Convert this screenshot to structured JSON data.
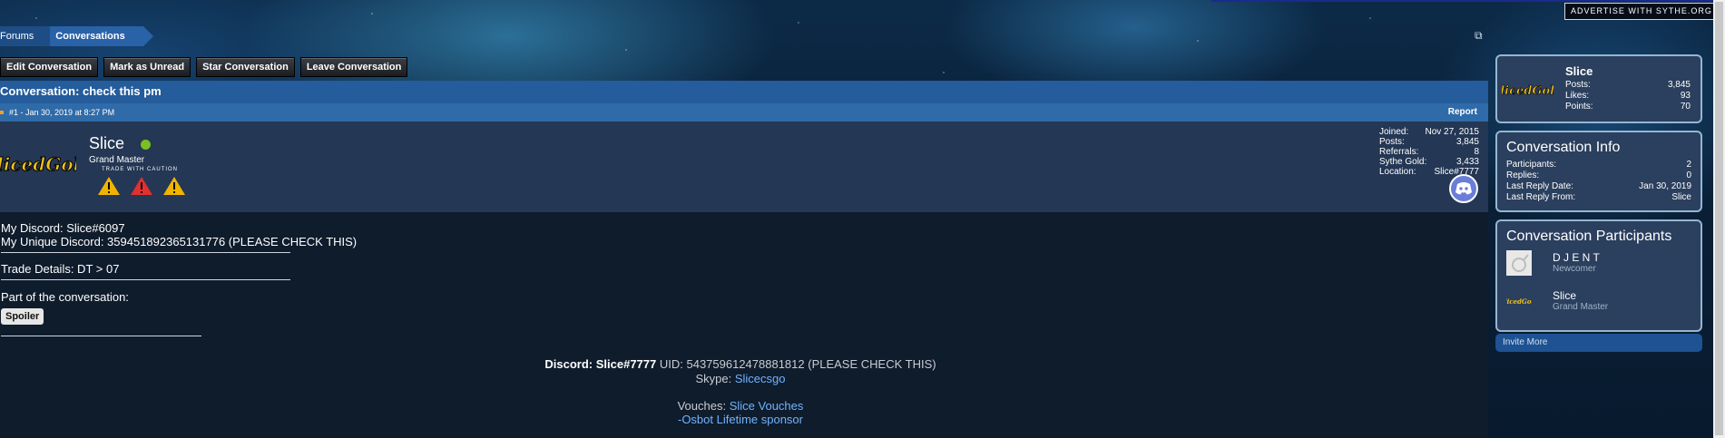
{
  "header": {
    "advertise_label": "ADVERTISE WITH SYTHE.ORG",
    "breadcrumbs": [
      "Forums",
      "Conversations"
    ]
  },
  "actions": {
    "edit": "Edit Conversation",
    "mark_unread": "Mark as Unread",
    "star": "Star Conversation",
    "leave": "Leave Conversation"
  },
  "conversation": {
    "title": "Conversation: check this pm",
    "message_meta": "#1 - Jan 30, 2019 at 8:27 PM",
    "report_label": "Report"
  },
  "poster": {
    "avatar_text": "SlicedGold",
    "name": "Slice",
    "rank": "Grand Master",
    "caution_label": "TRADE WITH CAUTION",
    "stats": [
      {
        "label": "Joined:",
        "value": "Nov 27, 2015"
      },
      {
        "label": "Posts:",
        "value": "3,845"
      },
      {
        "label": "Referrals:",
        "value": "8"
      },
      {
        "label": "Sythe Gold:",
        "value": "3,433"
      },
      {
        "label": "Location:",
        "value": "Slice#7777"
      }
    ]
  },
  "message": {
    "line1": "My Discord: Slice#6097",
    "line2": "My Unique Discord: 359451892365131776 (PLEASE CHECK THIS)",
    "trade_details": "Trade Details: DT > 07",
    "part_of": "Part of the conversation:",
    "spoiler_label": "Spoiler",
    "sig_discord_label": "Discord: Slice#7777",
    "sig_uid": "UID: 543759612478881812 (PLEASE CHECK THIS)",
    "sig_skype_label": "Skype:",
    "sig_skype_link": "Slicecsgo",
    "sig_vouches_label": "Vouches:",
    "sig_vouches_link": "Slice Vouches",
    "sig_sponsor": "-Osbot Lifetime sponsor"
  },
  "sidebar": {
    "visitor": {
      "name": "Slice",
      "stats": [
        {
          "label": "Posts:",
          "value": "3,845"
        },
        {
          "label": "Likes:",
          "value": "93"
        },
        {
          "label": "Points:",
          "value": "70"
        }
      ]
    },
    "info": {
      "title": "Conversation Info",
      "rows": [
        {
          "label": "Participants:",
          "value": "2"
        },
        {
          "label": "Replies:",
          "value": "0"
        },
        {
          "label": "Last Reply Date:",
          "value": "Jan 30, 2019"
        },
        {
          "label": "Last Reply From:",
          "value": "Slice"
        }
      ]
    },
    "participants": {
      "title": "Conversation Participants",
      "items": [
        {
          "name": "D J E N T",
          "rank": "Newcomer"
        },
        {
          "name": "Slice",
          "rank": "Grand Master"
        }
      ],
      "invite_label": "Invite More"
    }
  },
  "colors": {
    "title_bar": "#245c9c",
    "meta_bar": "#2f6ba8",
    "user_bar": "#243754",
    "content_bg": "#0f1c2c",
    "link": "#6fb3ff",
    "online": "#7ac020",
    "warning_yellow": "#f0b400",
    "warning_red": "#e03030"
  }
}
